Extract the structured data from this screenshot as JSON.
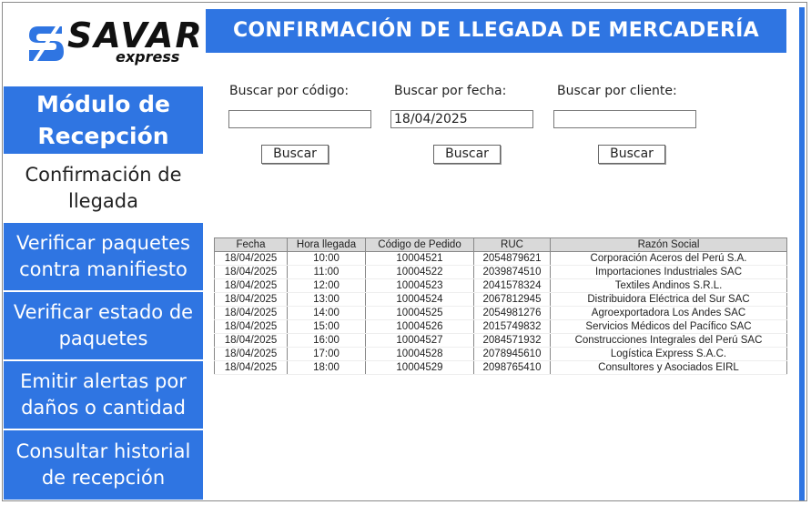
{
  "logo": {
    "word": "SAVAR",
    "sub": "express"
  },
  "sidebar": {
    "heading": [
      "Módulo de",
      "Recepción"
    ],
    "current": [
      "Confirmación de",
      "llegada"
    ],
    "items": [
      {
        "line1": "Verificar paquetes",
        "line2": "contra manifiesto"
      },
      {
        "line1": "Verificar estado de",
        "line2": "paquetes"
      },
      {
        "line1": "Emitir alertas por",
        "line2": "daños o cantidad"
      },
      {
        "line1": "Consultar historial",
        "line2": "de recepción"
      }
    ]
  },
  "header": {
    "title": "CONFIRMACIÓN DE LLEGADA DE MERCADERÍA"
  },
  "search": {
    "code_label": "Buscar por código:",
    "code_value": "",
    "date_label": "Buscar por fecha:",
    "date_value": "18/04/2025",
    "client_label": "Buscar por cliente:",
    "client_value": "",
    "button_label": "Buscar"
  },
  "table": {
    "columns": [
      "Fecha",
      "Hora llegada",
      "Código de Pedido",
      "RUC",
      "Razón Social"
    ],
    "rows": [
      [
        "18/04/2025",
        "10:00",
        "10004521",
        "2054879621",
        "Corporación Aceros del Perú S.A."
      ],
      [
        "18/04/2025",
        "11:00",
        "10004522",
        "2039874510",
        "Importaciones Industriales SAC"
      ],
      [
        "18/04/2025",
        "12:00",
        "10004523",
        "2041578324",
        "Textiles Andinos S.R.L."
      ],
      [
        "18/04/2025",
        "13:00",
        "10004524",
        "2067812945",
        "Distribuidora Eléctrica del Sur SAC"
      ],
      [
        "18/04/2025",
        "14:00",
        "10004525",
        "2054981276",
        "Agroexportadora Los Andes SAC"
      ],
      [
        "18/04/2025",
        "15:00",
        "10004526",
        "2015749832",
        "Servicios Médicos del Pacífico SAC"
      ],
      [
        "18/04/2025",
        "16:00",
        "10004527",
        "2084571932",
        "Construcciones Integrales del Perú SAC"
      ],
      [
        "18/04/2025",
        "17:00",
        "10004528",
        "2078945610",
        "Logística Express S.A.C."
      ],
      [
        "18/04/2025",
        "18:00",
        "10004529",
        "2098765410",
        "Consultores y Asociados EIRL"
      ]
    ]
  },
  "colors": {
    "accent": "#2f75e2",
    "table_header": "#d9d9d9"
  }
}
